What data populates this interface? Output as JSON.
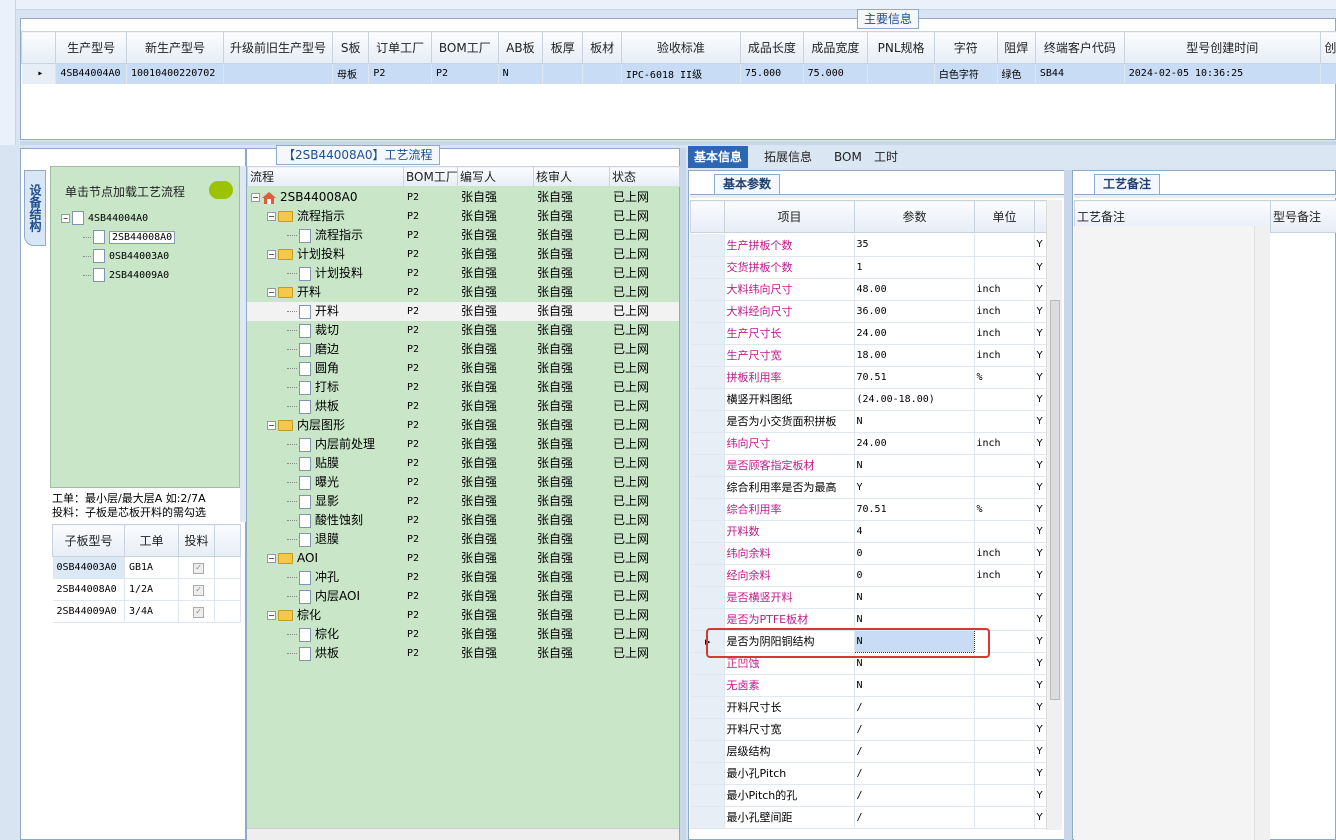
{
  "main_panel": {
    "title": "主要信息",
    "columns": [
      "生产型号",
      "新生产型号",
      "升级前旧生产型号",
      "S板",
      "订单工厂",
      "BOM工厂",
      "AB板",
      "板厚",
      "板材",
      "验收标准",
      "成品长度",
      "成品宽度",
      "PNL规格",
      "字符",
      "阻焊",
      "终端客户代码",
      "型号创建时间",
      "创"
    ],
    "row": [
      "4SB44004A0",
      "10010400220702",
      "",
      "母板",
      "P2",
      "P2",
      "N",
      "",
      "",
      "IPC-6018 II级",
      "75.000",
      "75.000",
      "",
      "白色字符",
      "绿色",
      "SB44",
      "2024-02-05 10:36:25",
      ""
    ]
  },
  "left_panel": {
    "vertical_tab": "设备结构",
    "hint": "单击节点加载工艺流程",
    "tree": {
      "root": "4SB44004A0",
      "children": [
        "2SB44008A0",
        "0SB44003A0",
        "2SB44009A0"
      ]
    },
    "notes": [
      "工单：最小层/最大层A 如:2/7A",
      "投料：子板是芯板开料的需勾选"
    ],
    "sub_table": {
      "columns": [
        "子板型号",
        "工单",
        "投料"
      ],
      "rows": [
        [
          "0SB44003A0",
          "GB1A",
          ""
        ],
        [
          "2SB44008A0",
          "1/2A",
          ""
        ],
        [
          "2SB44009A0",
          "3/4A",
          ""
        ]
      ]
    }
  },
  "process_panel": {
    "title": "【2SB44008A0】工艺流程",
    "columns": [
      "流程",
      "BOM工厂",
      "编写人",
      "核审人",
      "状态"
    ],
    "root": "2SB44008A0",
    "groups": [
      {
        "name": "流程指示",
        "children": [
          "流程指示"
        ]
      },
      {
        "name": "计划投料",
        "children": [
          "计划投料"
        ]
      },
      {
        "name": "开料",
        "children": [
          "开料",
          "裁切",
          "磨边",
          "圆角",
          "打标",
          "烘板"
        ]
      },
      {
        "name": "内层图形",
        "children": [
          "内层前处理",
          "贴膜",
          "曝光",
          "显影",
          "酸性蚀刻",
          "退膜"
        ]
      },
      {
        "name": "AOI",
        "children": [
          "冲孔",
          "内层AOI"
        ]
      },
      {
        "name": "棕化",
        "children": [
          "棕化",
          "烘板"
        ]
      }
    ],
    "factory": "P2",
    "writer": "张自强",
    "reviewer": "张自强",
    "status": "已上网"
  },
  "right_tabs": [
    "基本信息",
    "拓展信息",
    "BOM",
    "工时"
  ],
  "basic_params": {
    "subtab": "基本参数",
    "columns": [
      "项目",
      "参数",
      "单位"
    ],
    "rows": [
      {
        "item": "生产拼板个数",
        "value": "35",
        "unit": "",
        "pink": true
      },
      {
        "item": "交货拼板个数",
        "value": "1",
        "unit": "",
        "pink": true
      },
      {
        "item": "大料纬向尺寸",
        "value": "48.00",
        "unit": "inch",
        "pink": true
      },
      {
        "item": "大料经向尺寸",
        "value": "36.00",
        "unit": "inch",
        "pink": true
      },
      {
        "item": "生产尺寸长",
        "value": "24.00",
        "unit": "inch",
        "pink": true
      },
      {
        "item": "生产尺寸宽",
        "value": "18.00",
        "unit": "inch",
        "pink": true
      },
      {
        "item": "拼板利用率",
        "value": "70.51",
        "unit": "%",
        "pink": true
      },
      {
        "item": "横竖开料图纸",
        "value": "(24.00-18.00)",
        "unit": "",
        "pink": false
      },
      {
        "item": "是否为小交货面积拼板",
        "value": "N",
        "unit": "",
        "pink": false
      },
      {
        "item": "纬向尺寸",
        "value": "24.00",
        "unit": "inch",
        "pink": true
      },
      {
        "item": "是否顾客指定板材",
        "value": "N",
        "unit": "",
        "pink": true
      },
      {
        "item": "综合利用率是否为最高",
        "value": "Y",
        "unit": "",
        "pink": false
      },
      {
        "item": "综合利用率",
        "value": "70.51",
        "unit": "%",
        "pink": true
      },
      {
        "item": "开料数",
        "value": "4",
        "unit": "",
        "pink": true
      },
      {
        "item": "纬向余料",
        "value": "0",
        "unit": "inch",
        "pink": true
      },
      {
        "item": "经向余料",
        "value": "0",
        "unit": "inch",
        "pink": true
      },
      {
        "item": "是否横竖开料",
        "value": "N",
        "unit": "",
        "pink": true
      },
      {
        "item": "是否为PTFE板材",
        "value": "N",
        "unit": "",
        "pink": true
      },
      {
        "item": "是否为阴阳铜结构",
        "value": "N",
        "unit": "",
        "pink": false
      },
      {
        "item": "正凹蚀",
        "value": "N",
        "unit": "",
        "pink": true
      },
      {
        "item": "无卤素",
        "value": "N",
        "unit": "",
        "pink": true
      },
      {
        "item": "开料尺寸长",
        "value": "/",
        "unit": "",
        "pink": false
      },
      {
        "item": "开料尺寸宽",
        "value": "/",
        "unit": "",
        "pink": false
      },
      {
        "item": "层级结构",
        "value": "/",
        "unit": "",
        "pink": false
      },
      {
        "item": "最小孔Pitch",
        "value": "/",
        "unit": "",
        "pink": false
      },
      {
        "item": "最小Pitch的孔",
        "value": "/",
        "unit": "",
        "pink": false
      },
      {
        "item": "最小孔壁间距",
        "value": "/",
        "unit": "",
        "pink": false
      }
    ],
    "flag": "Y"
  },
  "remark_panel": {
    "subtab": "工艺备注",
    "columns": [
      "工艺备注",
      "型号备注"
    ]
  }
}
